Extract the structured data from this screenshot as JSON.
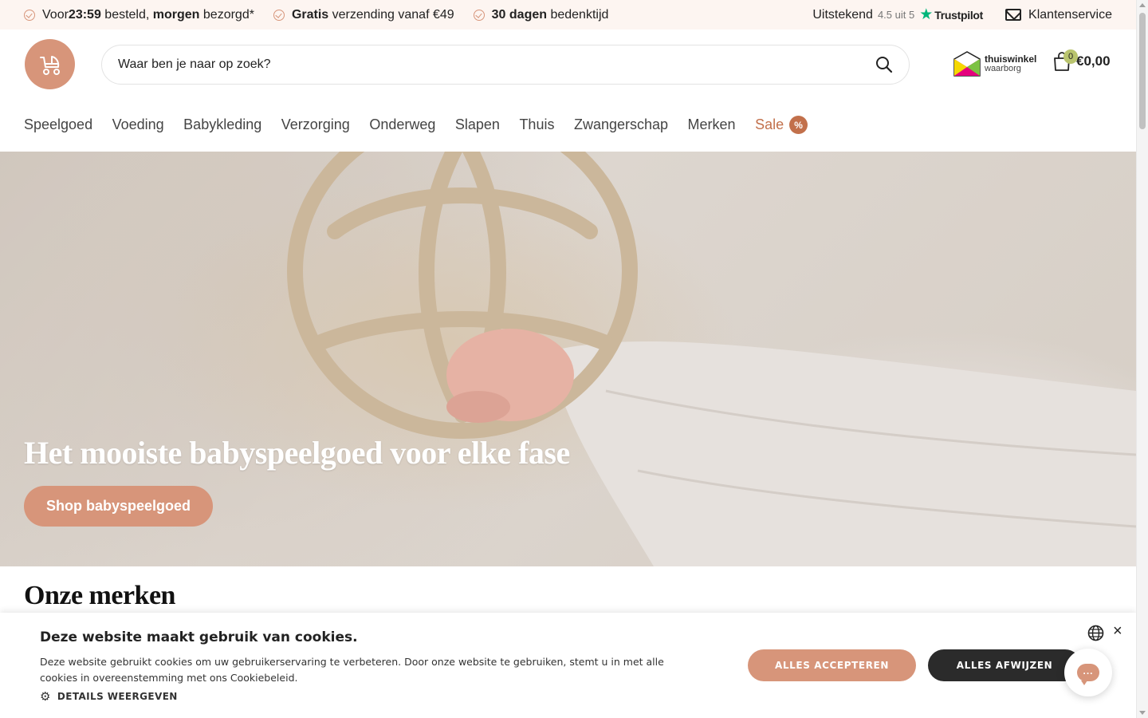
{
  "usp_bar": {
    "items": [
      {
        "pre": "Voor ",
        "b1": "23:59",
        "mid": " besteld, ",
        "b2": "morgen",
        "post": " bezorgd*"
      },
      {
        "b1": "Gratis",
        "post": " verzending vanaf €49"
      },
      {
        "b1": "30 dagen",
        "post": " bedenktijd"
      }
    ],
    "trustpilot": {
      "word": "Uitstekend",
      "score": "4.5 uit 5",
      "brand": "Trustpilot"
    },
    "customer_service": "Klantenservice"
  },
  "header": {
    "search_placeholder": "Waar ben je naar op zoek?",
    "thuiswinkel": {
      "line1": "thuiswinkel",
      "line2": "waarborg"
    },
    "cart": {
      "count": "0",
      "total": "€0,00"
    }
  },
  "nav": {
    "items": [
      "Speelgoed",
      "Voeding",
      "Babykleding",
      "Verzorging",
      "Onderweg",
      "Slapen",
      "Thuis",
      "Zwangerschap",
      "Merken"
    ],
    "sale_label": "Sale",
    "sale_badge": "%"
  },
  "hero": {
    "title": "Het mooiste babyspeelgoed voor elke fase",
    "cta": "Shop babyspeelgoed"
  },
  "brands_title": "Onze merken",
  "cookie": {
    "title": "Deze website maakt gebruik van cookies.",
    "text": "Deze website gebruikt cookies om uw gebruikerservaring te verbeteren. Door onze website te gebruiken, stemt u in met alle cookies in overeenstemming met ons Cookiebeleid.",
    "details": "DETAILS WEERGEVEN",
    "accept": "ALLES ACCEPTEREN",
    "reject": "ALLES AFWIJZEN",
    "close": "×"
  },
  "colors": {
    "accent": "#d7957a",
    "sale": "#c2704b",
    "dark": "#2b2b2b",
    "usp_bg": "#fdf5f1"
  }
}
